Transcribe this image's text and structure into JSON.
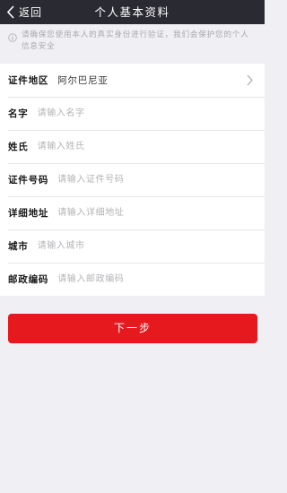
{
  "nav": {
    "back_label": "返回",
    "title": "个人基本资料"
  },
  "notice": {
    "icon": "info-circle-icon",
    "text": "请确保您使用本人的真实身份进行验证，我们会保护您的个人信息安全"
  },
  "form": {
    "region": {
      "label": "证件地区",
      "value": "阿尔巴尼亚"
    },
    "first_name": {
      "label": "名字",
      "placeholder": "请输入名字"
    },
    "last_name": {
      "label": "姓氏",
      "placeholder": "请输入姓氏"
    },
    "id_number": {
      "label": "证件号码",
      "placeholder": "请输入证件号码"
    },
    "address": {
      "label": "详细地址",
      "placeholder": "请输入详细地址"
    },
    "city": {
      "label": "城市",
      "placeholder": "请输入城市"
    },
    "postcode": {
      "label": "邮政编码",
      "placeholder": "请输入邮政编码"
    }
  },
  "next_button": {
    "label": "下一步"
  },
  "colors": {
    "navbar": "#2a2a32",
    "background": "#efeff4",
    "accent": "#e5191e"
  }
}
